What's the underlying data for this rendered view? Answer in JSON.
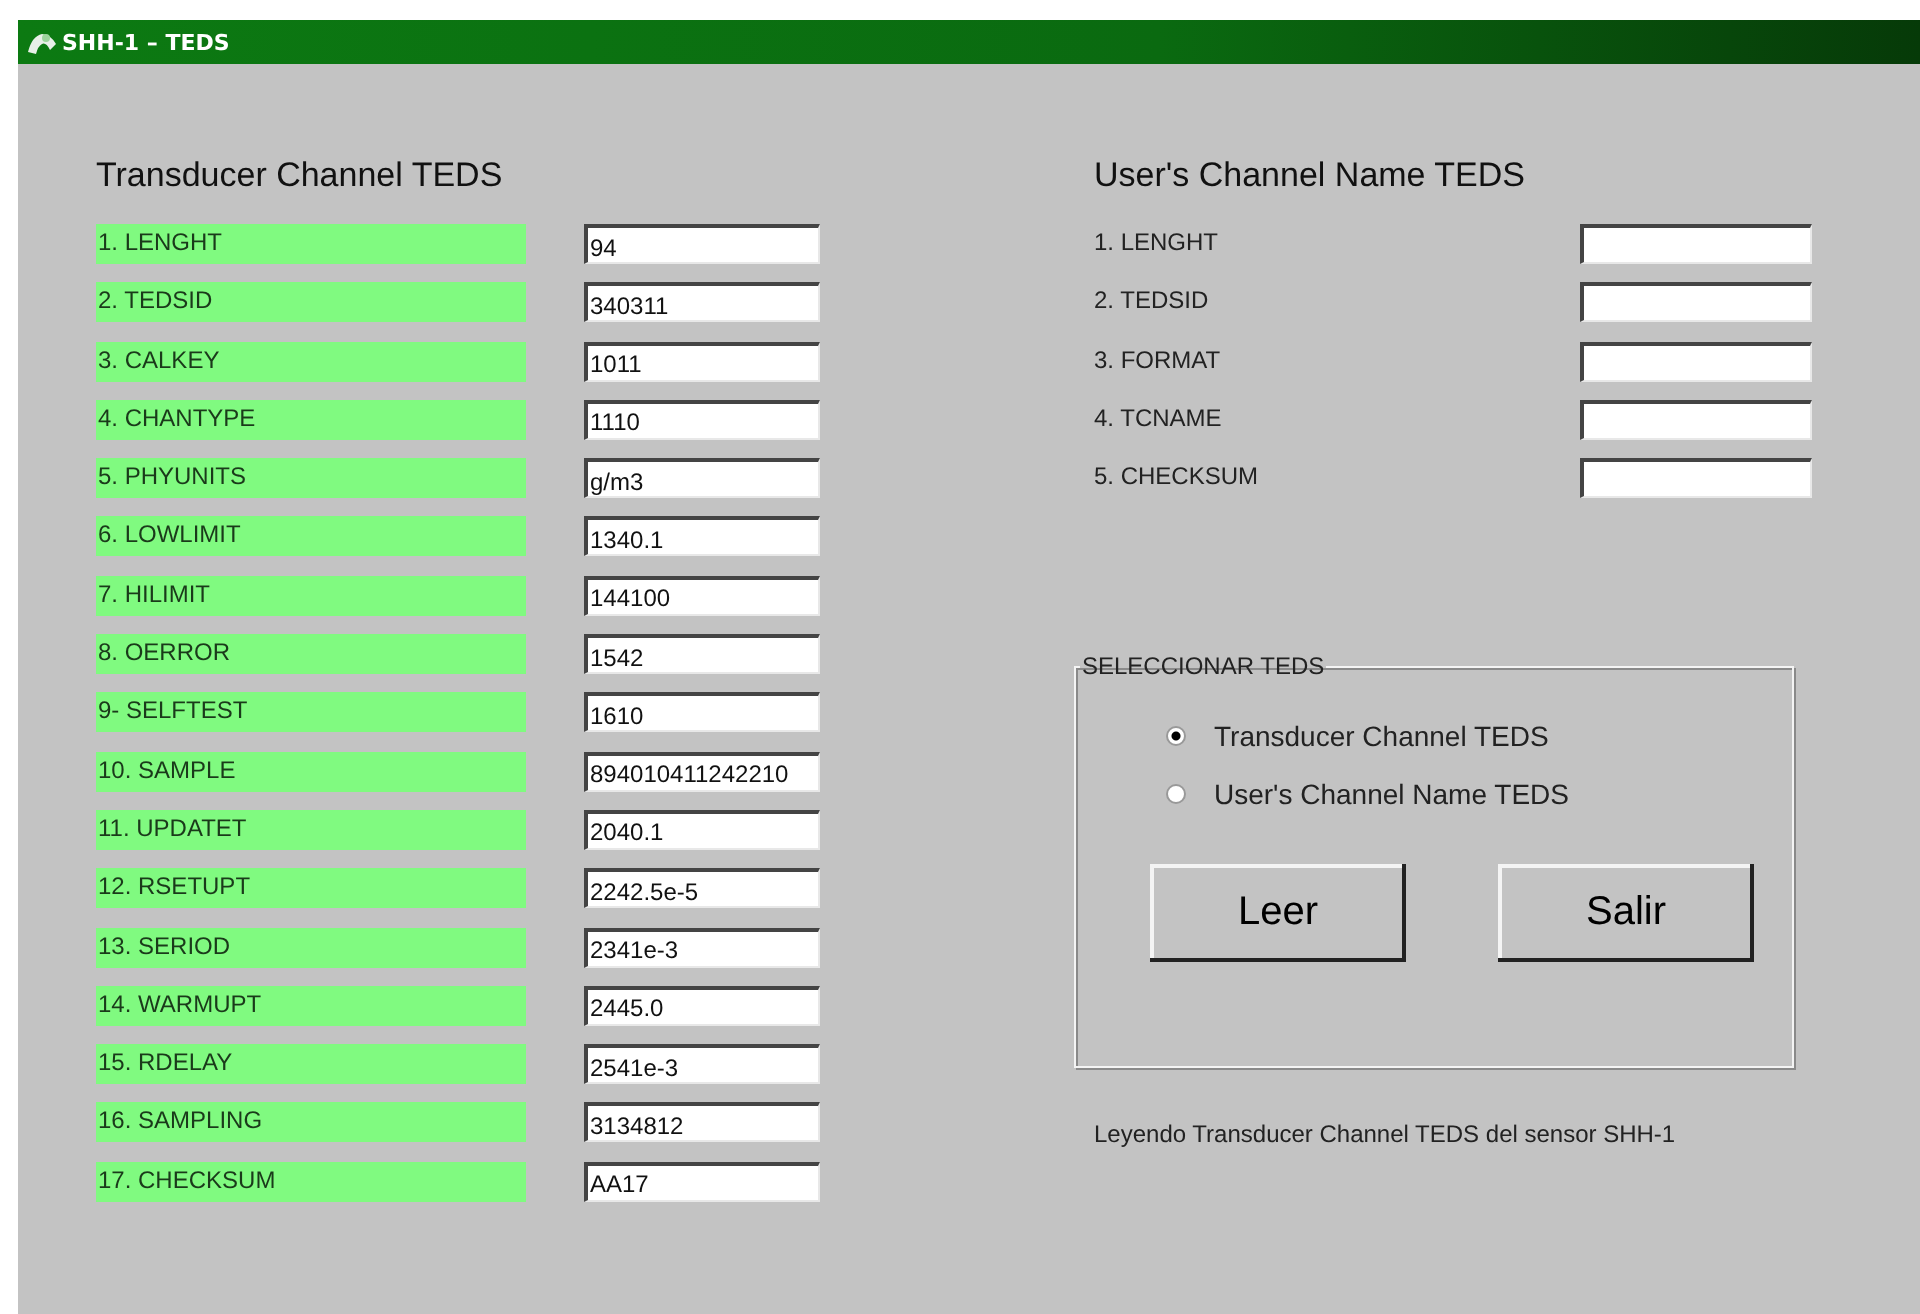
{
  "window": {
    "title": "SHH-1 – TEDS"
  },
  "transducer": {
    "heading": "Transducer Channel TEDS",
    "rows": [
      {
        "label": "1. LENGHT",
        "value": "94"
      },
      {
        "label": "2. TEDSID",
        "value": "340311"
      },
      {
        "label": "3. CALKEY",
        "value": "1011"
      },
      {
        "label": "4. CHANTYPE",
        "value": "1110"
      },
      {
        "label": "5. PHYUNITS",
        "value": "g/m3"
      },
      {
        "label": "6. LOWLIMIT",
        "value": "1340.1"
      },
      {
        "label": "7. HILIMIT",
        "value": "144100"
      },
      {
        "label": "8. OERROR",
        "value": "1542"
      },
      {
        "label": "9- SELFTEST",
        "value": "1610"
      },
      {
        "label": "10. SAMPLE",
        "value": "894010411242210"
      },
      {
        "label": "11. UPDATET",
        "value": "2040.1"
      },
      {
        "label": "12. RSETUPT",
        "value": "2242.5e-5"
      },
      {
        "label": "13. SERIOD",
        "value": "2341e-3"
      },
      {
        "label": "14. WARMUPT",
        "value": "2445.0"
      },
      {
        "label": "15. RDELAY",
        "value": "2541e-3"
      },
      {
        "label": "16. SAMPLING",
        "value": "3134812"
      },
      {
        "label": "17. CHECKSUM",
        "value": "AA17"
      }
    ]
  },
  "user": {
    "heading": "User's Channel Name TEDS",
    "rows": [
      {
        "label": "1. LENGHT"
      },
      {
        "label": "2. TEDSID"
      },
      {
        "label": "3. FORMAT"
      },
      {
        "label": "4. TCNAME"
      },
      {
        "label": "5. CHECKSUM"
      }
    ]
  },
  "selector": {
    "legend": "SELECCIONAR TEDS",
    "options": [
      {
        "label": "Transducer Channel TEDS",
        "selected": true
      },
      {
        "label": "User's Channel Name TEDS",
        "selected": false
      }
    ],
    "buttons": [
      "Leer",
      "Salir"
    ]
  },
  "status": "Leyendo Transducer Channel TEDS del sensor SHH-1"
}
